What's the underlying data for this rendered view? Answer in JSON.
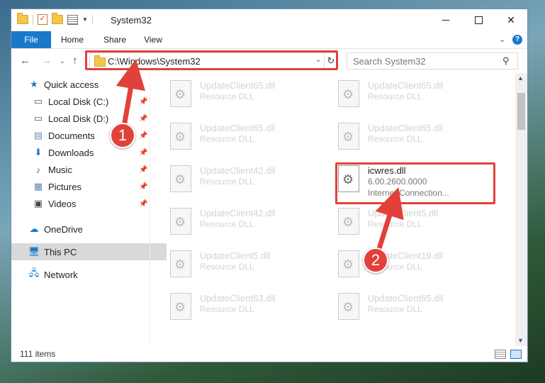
{
  "window": {
    "title": "System32",
    "controls": {
      "minimize": "—",
      "maximize": "☐",
      "close": "✕"
    }
  },
  "ribbon": {
    "tabs": [
      "File",
      "Home",
      "Share",
      "View"
    ],
    "help": "?"
  },
  "nav": {
    "address": "C:\\Windows\\System32",
    "search_placeholder": "Search System32"
  },
  "sidebar": {
    "items": [
      {
        "label": "Quick access",
        "icon": "star-icon",
        "pinned": false
      },
      {
        "label": "Local Disk (C:)",
        "icon": "drive-icon",
        "pinned": true
      },
      {
        "label": "Local Disk (D:)",
        "icon": "drive-icon",
        "pinned": true
      },
      {
        "label": "Documents",
        "icon": "documents-icon",
        "pinned": true
      },
      {
        "label": "Downloads",
        "icon": "download-icon",
        "pinned": true
      },
      {
        "label": "Music",
        "icon": "music-icon",
        "pinned": true
      },
      {
        "label": "Pictures",
        "icon": "pictures-icon",
        "pinned": true
      },
      {
        "label": "Videos",
        "icon": "videos-icon",
        "pinned": true
      },
      {
        "label": "OneDrive",
        "icon": "cloud-icon",
        "pinned": false
      },
      {
        "label": "This PC",
        "icon": "computer-icon",
        "pinned": false,
        "selected": true
      },
      {
        "label": "Network",
        "icon": "network-icon",
        "pinned": false
      }
    ]
  },
  "files": {
    "left_column": [
      {
        "name": "UpdateClient65.dll",
        "desc": "Resource DLL"
      },
      {
        "name": "UpdateClient65.dll",
        "desc": "Resource DLL"
      },
      {
        "name": "UpdateClient42.dll",
        "desc": "Resource DLL"
      },
      {
        "name": "UpdateClient42.dll",
        "desc": "Resource DLL"
      },
      {
        "name": "UpdateClient5.dll",
        "desc": "Resource DLL"
      },
      {
        "name": "UpdateClient63.dll",
        "desc": "Resource DLL"
      }
    ],
    "right_column": [
      {
        "name": "UpdateClient65.dll",
        "desc": "Resource DLL"
      },
      {
        "name": "UpdateClient65.dll",
        "desc": "Resource DLL"
      },
      {
        "name": "icwres.dll",
        "version": "6.00.2600.0000",
        "desc": "Internet Connection...",
        "highlighted": true
      },
      {
        "name": "UpdateClient5.dll",
        "desc": "Resource DLL"
      },
      {
        "name": "UpdateClient19.dll",
        "desc": "Resource DLL"
      },
      {
        "name": "UpdateClient65.dll",
        "desc": "Resource DLL"
      }
    ]
  },
  "status": {
    "item_count": "111 items"
  },
  "callouts": [
    "1",
    "2"
  ],
  "colors": {
    "accent": "#1979ca",
    "highlight": "#e2413b",
    "selection": "#d9d9d9"
  }
}
